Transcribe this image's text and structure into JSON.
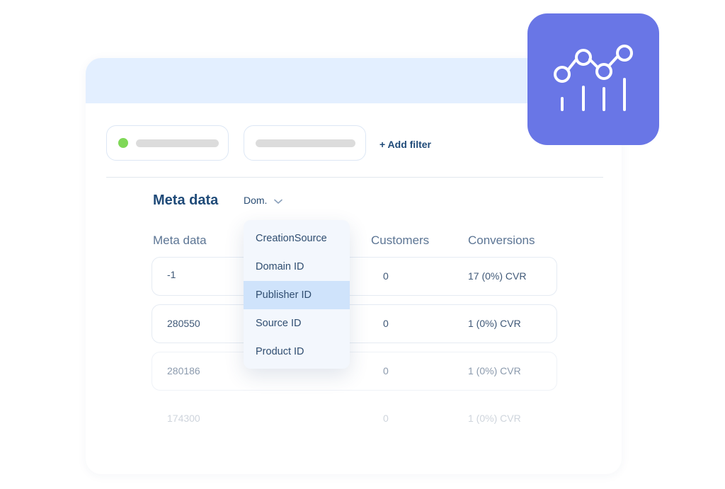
{
  "filters": {
    "add_filter_label": "+ Add filter"
  },
  "section": {
    "title": "Meta data",
    "dom_select": "Dom."
  },
  "table": {
    "columns": [
      "Meta data",
      "Customers",
      "Conversions"
    ],
    "rows": [
      {
        "meta": "-1",
        "customers": "0",
        "conversions": "17 (0%) CVR"
      },
      {
        "meta": "280550",
        "customers": "0",
        "conversions": "1 (0%) CVR"
      },
      {
        "meta": "280186",
        "customers": "0",
        "conversions": "1 (0%) CVR"
      },
      {
        "meta": "174300",
        "customers": "0",
        "conversions": "1 (0%) CVR"
      }
    ]
  },
  "dropdown": {
    "options": [
      "CreationSource",
      "Domain ID",
      "Publisher ID",
      "Source ID",
      "Product ID"
    ],
    "selected": "Publisher ID"
  },
  "colors": {
    "accent": "#6976e6",
    "header_band": "#e3efff",
    "status_green": "#7fd857",
    "selected_option": "#cfe3fb"
  },
  "icons": {
    "badge": "analytics-chart-icon",
    "select_arrow": "chevron-down-icon"
  }
}
